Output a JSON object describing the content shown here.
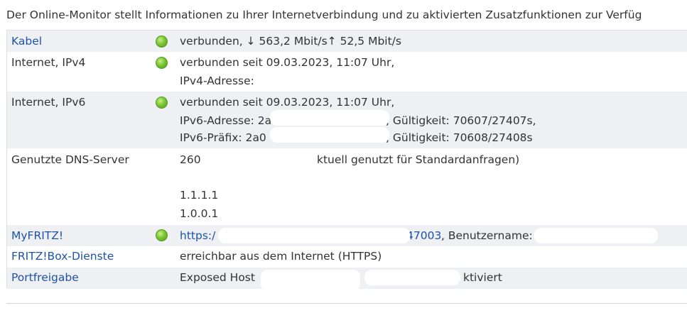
{
  "intro": "Der Online-Monitor stellt Informationen zu Ihrer Internetverbindung und zu aktivierten Zusatzfunktionen zur Verfüg",
  "rows": {
    "kabel": {
      "label": "Kabel",
      "value": "verbunden, ↓ 563,2 Mbit/s↑ 52,5 Mbit/s",
      "status": "green"
    },
    "ipv4": {
      "label": "Internet, IPv4",
      "line1": "verbunden seit 09.03.2023, 11:07 Uhr,",
      "line2": "IPv4-Adresse:",
      "status": "green"
    },
    "ipv6": {
      "label": "Internet, IPv6",
      "line1": "verbunden seit 09.03.2023, 11:07 Uhr,",
      "line2_start": "IPv6-Adresse: 2a0",
      "line2_end": ", Gültigkeit: 70607/27407s,",
      "line3_start": "IPv6-Präfix: 2a0",
      "line3_end": ", Gültigkeit: 70608/27408s",
      "status": "green"
    },
    "dns": {
      "label": "Genutzte DNS-Server",
      "line1_start": "260",
      "line1_end": "ktuell genutzt für Standardanfragen)",
      "server2": "1.1.1.1",
      "server3": "1.0.0.1"
    },
    "myfritz": {
      "label": "MyFRITZ!",
      "url_start": "https:/",
      "url_end": "47003",
      "user_label": ", Benutzername:",
      "status": "green"
    },
    "dienste": {
      "label": "FRITZ!Box-Dienste",
      "value": "erreichbar aus dem Internet (HTTPS)"
    },
    "portfreigabe": {
      "label": "Portfreigabe",
      "value_start": "Exposed Host",
      "value_end": "ktiviert"
    }
  },
  "colors": {
    "link": "#1d53a6",
    "text": "#333333",
    "row_alt": "#eef0f4",
    "status_green": "#7cc533"
  }
}
